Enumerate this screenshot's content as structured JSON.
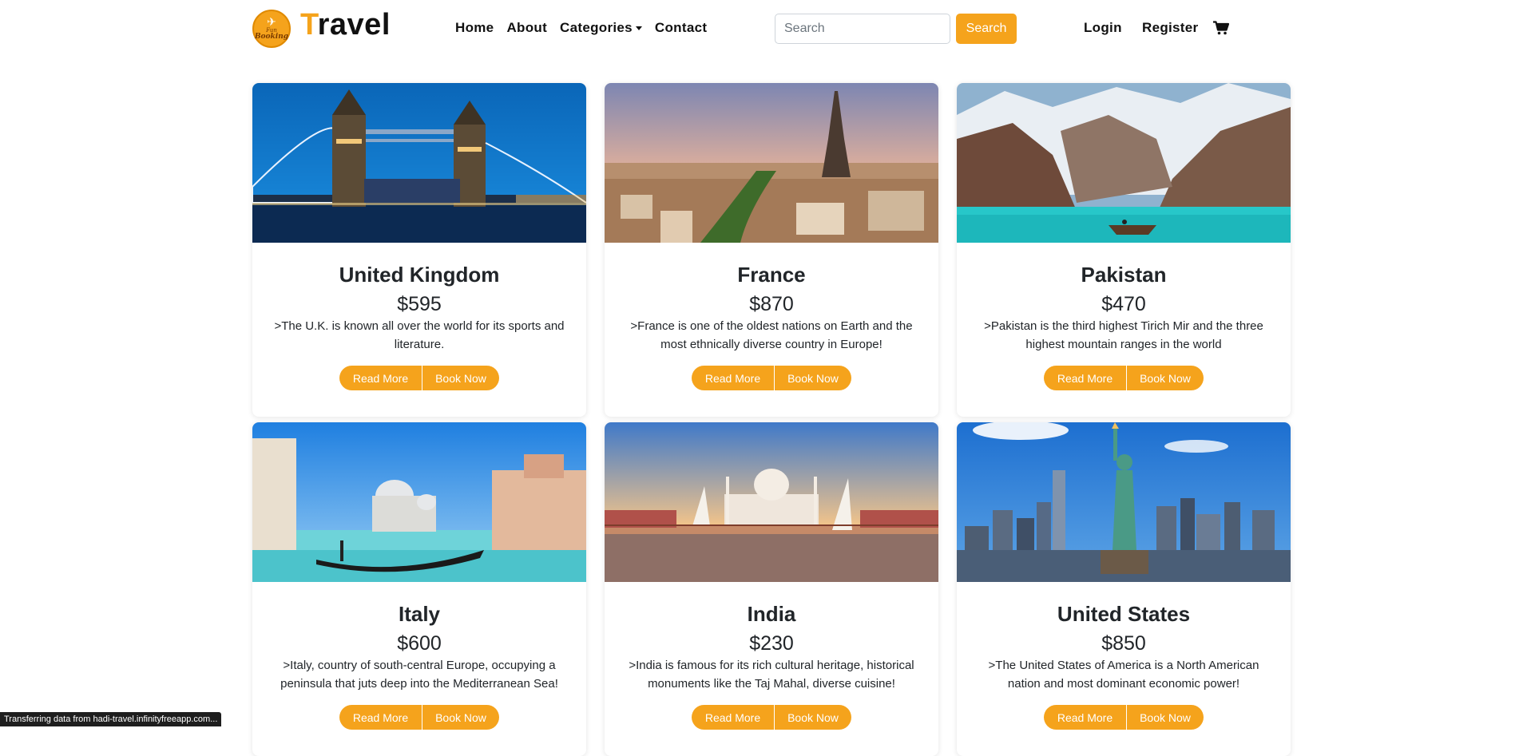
{
  "header": {
    "logo": {
      "icon": "plane-icon",
      "line1": "Fun",
      "line2": "Booking"
    },
    "brand_first": "T",
    "brand_rest": "ravel",
    "nav": [
      {
        "label": "Home"
      },
      {
        "label": "About"
      },
      {
        "label": "Categories",
        "icon": "chevron-down-icon"
      },
      {
        "label": "Contact"
      }
    ],
    "search": {
      "placeholder": "Search",
      "value": "",
      "button": "Search"
    },
    "login": "Login",
    "register": "Register",
    "cart_icon": "cart-icon"
  },
  "cards": [
    {
      "title": "United Kingdom",
      "price": "$595",
      "text": ">The U.K. is known all over the world for its sports and literature.",
      "read_more": "Read More",
      "book_now": "Book Now"
    },
    {
      "title": "France",
      "price": "$870",
      "text": ">France is one of the oldest nations on Earth and the most ethnically diverse country in Europe!",
      "read_more": "Read More",
      "book_now": "Book Now"
    },
    {
      "title": "Pakistan",
      "price": "$470",
      "text": ">Pakistan is the third highest Tirich Mir and the three highest mountain ranges in the world",
      "read_more": "Read More",
      "book_now": "Book Now"
    },
    {
      "title": "Italy",
      "price": "$600",
      "text": ">Italy, country of south-central Europe, occupying a peninsula that juts deep into the Mediterranean Sea!",
      "read_more": "Read More",
      "book_now": "Book Now"
    },
    {
      "title": "India",
      "price": "$230",
      "text": ">India is famous for its rich cultural heritage, historical monuments like the Taj Mahal, diverse cuisine!",
      "read_more": "Read More",
      "book_now": "Book Now"
    },
    {
      "title": "United States",
      "price": "$850",
      "text": ">The United States of America is a North American nation and most dominant economic power!",
      "read_more": "Read More",
      "book_now": "Book Now"
    }
  ],
  "status_bar": "Transferring data from hadi-travel.infinityfreeapp.com...",
  "colors": {
    "accent": "#f5a31c",
    "text": "#212529",
    "background": "#ffffff"
  }
}
